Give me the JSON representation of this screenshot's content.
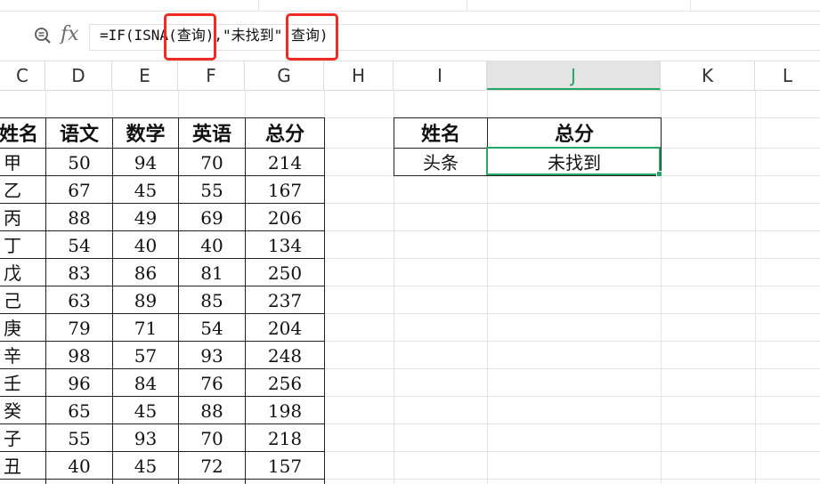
{
  "formula_bar": {
    "zoom_icon": "zoom-formula-icon",
    "fx_label": "fx",
    "formula": "=IF(ISNA(查询),\"未找到\" 查询)",
    "highlight_color": "#ef2b22"
  },
  "columns": [
    "C",
    "D",
    "E",
    "F",
    "G",
    "H",
    "I",
    "J",
    "K",
    "L"
  ],
  "selected_column": "J",
  "accent_color": "#27a566",
  "score_table": {
    "headers": [
      "姓名",
      "语文",
      "数学",
      "英语",
      "总分"
    ],
    "rows": [
      [
        "甲",
        "50",
        "94",
        "70",
        "214"
      ],
      [
        "乙",
        "67",
        "45",
        "55",
        "167"
      ],
      [
        "丙",
        "88",
        "49",
        "69",
        "206"
      ],
      [
        "丁",
        "54",
        "40",
        "40",
        "134"
      ],
      [
        "戊",
        "83",
        "86",
        "81",
        "250"
      ],
      [
        "己",
        "63",
        "89",
        "85",
        "237"
      ],
      [
        "庚",
        "79",
        "71",
        "54",
        "204"
      ],
      [
        "辛",
        "98",
        "57",
        "93",
        "248"
      ],
      [
        "壬",
        "96",
        "84",
        "76",
        "256"
      ],
      [
        "癸",
        "65",
        "45",
        "88",
        "198"
      ],
      [
        "子",
        "55",
        "93",
        "70",
        "218"
      ],
      [
        "丑",
        "40",
        "45",
        "72",
        "157"
      ]
    ]
  },
  "lookup_table": {
    "headers": [
      "姓名",
      "总分"
    ],
    "row": [
      "头条",
      "未找到"
    ]
  }
}
